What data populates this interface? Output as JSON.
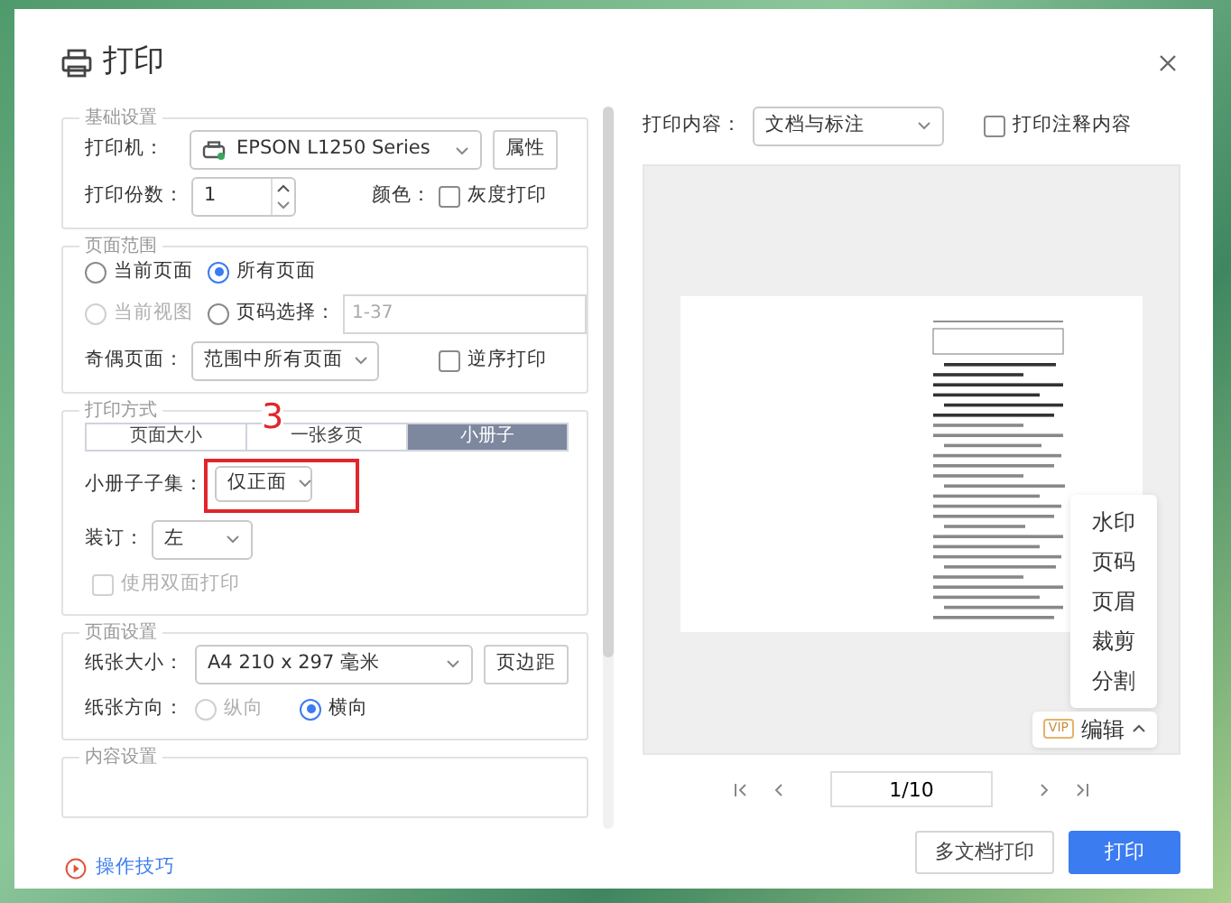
{
  "dialog": {
    "title": "打印"
  },
  "basic": {
    "legend": "基础设置",
    "printer_label": "打印机：",
    "printer": "EPSON L1250 Series",
    "properties_button": "属性",
    "copies_label": "打印份数：",
    "copies": "1",
    "color_label": "颜色：",
    "grayscale": {
      "label": "灰度打印",
      "checked": false
    }
  },
  "page_range": {
    "legend": "页面范围",
    "options": [
      {
        "label": "当前页面",
        "selected": false,
        "disabled": false
      },
      {
        "label": "所有页面",
        "selected": true,
        "disabled": false
      },
      {
        "label": "当前视图",
        "selected": false,
        "disabled": true
      },
      {
        "label": "页码选择：",
        "selected": false,
        "disabled": false,
        "placeholder": "1-37"
      }
    ],
    "parity_label": "奇偶页面：",
    "parity": "范围中所有页面",
    "reverse": {
      "label": "逆序打印",
      "checked": false
    }
  },
  "print_mode": {
    "legend": "打印方式",
    "annotation": "3",
    "tabs": [
      {
        "label": "页面大小",
        "selected": false
      },
      {
        "label": "一张多页",
        "selected": false
      },
      {
        "label": "小册子",
        "selected": true
      }
    ],
    "subset_label": "小册子子集：",
    "subset": "仅正面",
    "binding_label": "装订：",
    "binding": "左",
    "duplex": {
      "label": "使用双面打印",
      "checked": false,
      "disabled": true
    }
  },
  "page_setup": {
    "legend": "页面设置",
    "paper_label": "纸张大小：",
    "paper": "A4 210 x 297 毫米",
    "margins_button": "页边距",
    "orientation_label": "纸张方向：",
    "orientations": [
      {
        "label": "纵向",
        "selected": false,
        "disabled": true
      },
      {
        "label": "横向",
        "selected": true,
        "disabled": false
      }
    ]
  },
  "content_setup": {
    "legend": "内容设置"
  },
  "tips_link": "操作技巧",
  "print_content": {
    "label": "打印内容：",
    "value": "文档与标注",
    "annotations": {
      "label": "打印注释内容",
      "checked": false
    }
  },
  "edit_menu": {
    "items": [
      "水印",
      "页码",
      "页眉",
      "裁剪",
      "分割"
    ],
    "vip": "VIP",
    "button": "编辑",
    "expanded": true
  },
  "pager": {
    "page": "1/10"
  },
  "buttons": {
    "multi": "多文档打印",
    "print": "打印"
  }
}
